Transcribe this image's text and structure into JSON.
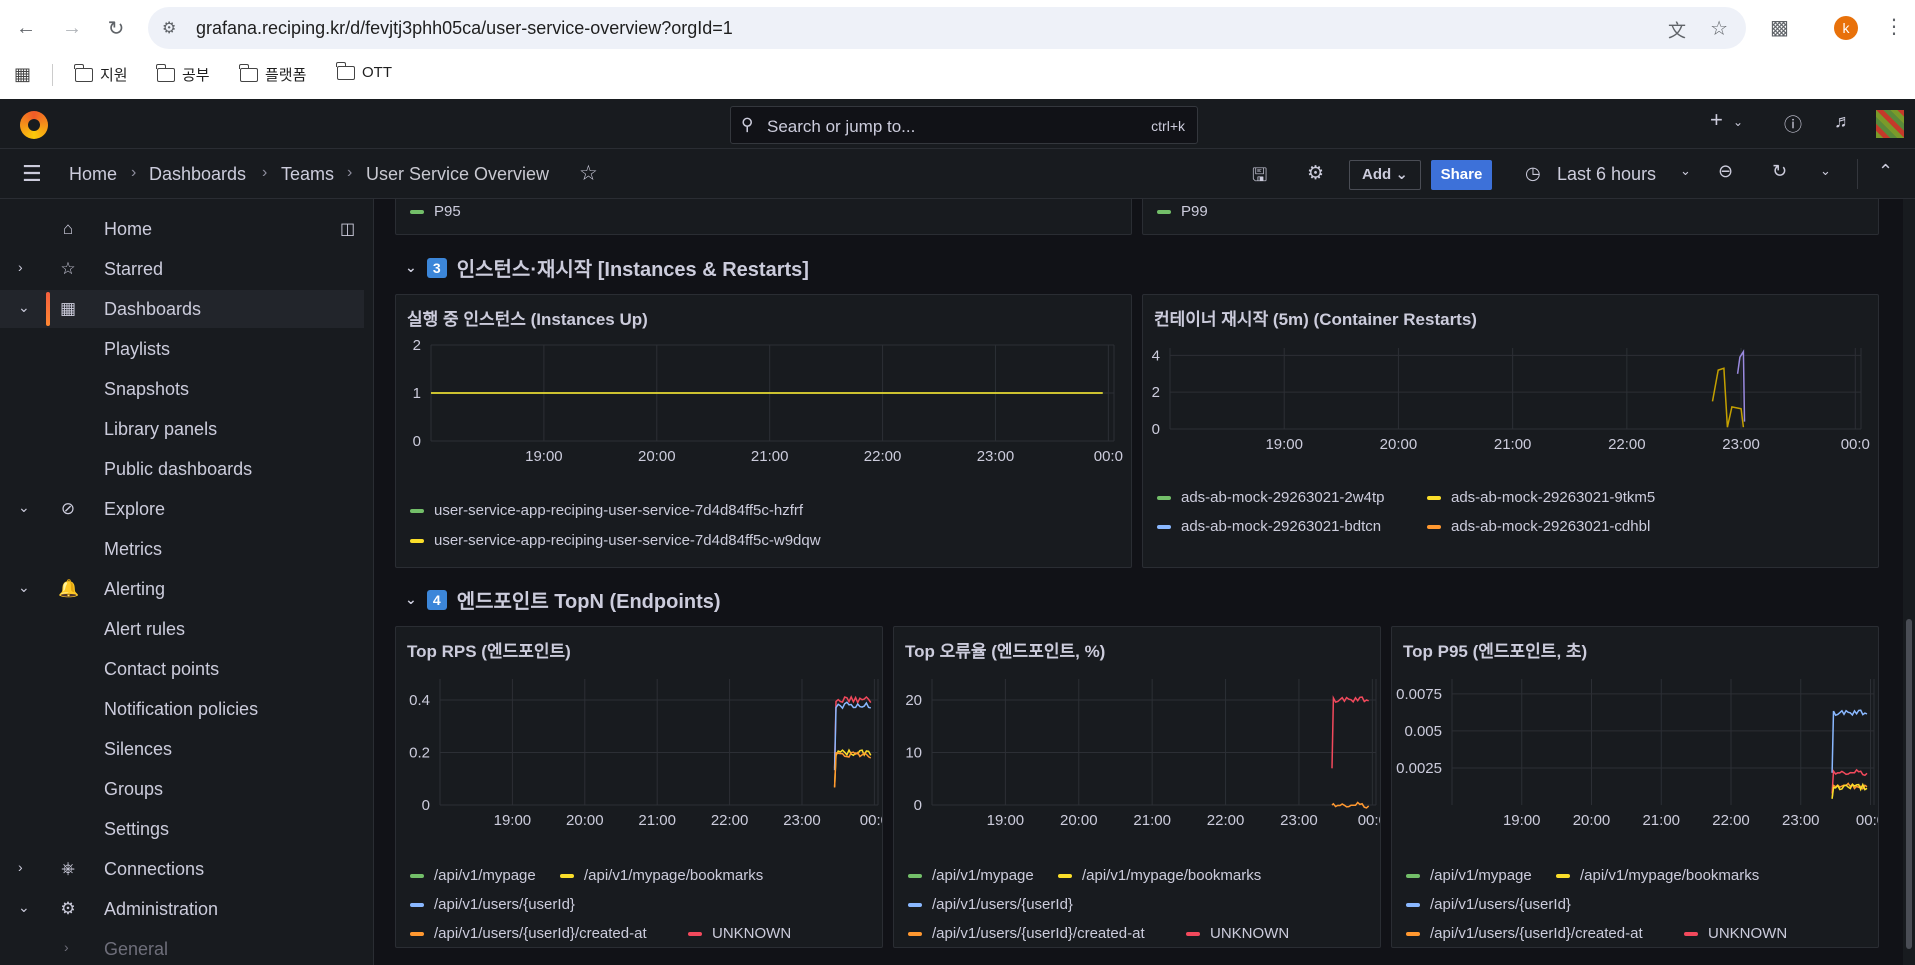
{
  "browser": {
    "url": "grafana.reciping.kr/d/fevjtj3phh05ca/user-service-overview?orgId=1",
    "bookmarks": [
      "지원",
      "공부",
      "플랫폼",
      "OTT"
    ],
    "profile_initial": "k"
  },
  "header": {
    "search_placeholder": "Search or jump to...",
    "search_shortcut": "ctrl+k"
  },
  "breadcrumb": {
    "home": "Home",
    "dashboards": "Dashboards",
    "teams": "Teams",
    "current": "User Service Overview"
  },
  "toolbar": {
    "add_label": "Add",
    "share_label": "Share",
    "time_range": "Last 6 hours"
  },
  "sidebar": {
    "items": [
      {
        "label": "Home",
        "icon": "home-icon"
      },
      {
        "label": "Starred",
        "icon": "star-icon"
      },
      {
        "label": "Dashboards",
        "icon": "apps-icon"
      },
      {
        "label": "Playlists"
      },
      {
        "label": "Snapshots"
      },
      {
        "label": "Library panels"
      },
      {
        "label": "Public dashboards"
      },
      {
        "label": "Explore",
        "icon": "compass-icon"
      },
      {
        "label": "Metrics"
      },
      {
        "label": "Alerting",
        "icon": "bell-icon"
      },
      {
        "label": "Alert rules"
      },
      {
        "label": "Contact points"
      },
      {
        "label": "Notification policies"
      },
      {
        "label": "Silences"
      },
      {
        "label": "Groups"
      },
      {
        "label": "Settings"
      },
      {
        "label": "Connections",
        "icon": "connections-icon"
      },
      {
        "label": "Administration",
        "icon": "cog-icon"
      },
      {
        "label": "General"
      }
    ]
  },
  "top_legends": {
    "left": "P95",
    "right": "P99"
  },
  "rows": {
    "row3": {
      "badge": "3",
      "title": "인스턴스·재시작 [Instances & Restarts]"
    },
    "row4": {
      "badge": "4",
      "title": "엔드포인트 TopN (Endpoints)"
    }
  },
  "panels": {
    "instances": {
      "title": "실행 중 인스턴스 (Instances Up)",
      "legend": [
        {
          "name": "user-service-app-reciping-user-service-7d4d84ff5c-hzfrf",
          "color": "#73bf69"
        },
        {
          "name": "user-service-app-reciping-user-service-7d4d84ff5c-w9dqw",
          "color": "#fade2a"
        }
      ]
    },
    "restarts": {
      "title": "컨테이너 재시작 (5m) (Container Restarts)",
      "legend": [
        {
          "name": "ads-ab-mock-29263021-2w4tp",
          "color": "#73bf69"
        },
        {
          "name": "ads-ab-mock-29263021-9tkm5",
          "color": "#fade2a"
        },
        {
          "name": "ads-ab-mock-29263021-bdtcn",
          "color": "#8ab8ff"
        },
        {
          "name": "ads-ab-mock-29263021-cdhbl",
          "color": "#ff9830"
        }
      ]
    },
    "top_rps": {
      "title": "Top RPS (엔드포인트)"
    },
    "top_err": {
      "title": "Top 오류율 (엔드포인트, %)"
    },
    "top_p95": {
      "title": "Top P95 (엔드포인트, 초)"
    },
    "endpoint_legend": [
      {
        "name": "/api/v1/mypage",
        "color": "#73bf69"
      },
      {
        "name": "/api/v1/mypage/bookmarks",
        "color": "#fade2a"
      },
      {
        "name": "/api/v1/users/{userId}",
        "color": "#8ab8ff"
      },
      {
        "name": "/api/v1/users/{userId}/created-at",
        "color": "#ff9830"
      },
      {
        "name": "UNKNOWN",
        "color": "#f2495c"
      }
    ]
  },
  "chart_data": [
    {
      "type": "line",
      "title": "실행 중 인스턴스 (Instances Up)",
      "x_ticks": [
        "19:00",
        "20:00",
        "21:00",
        "22:00",
        "23:00",
        "00:0"
      ],
      "y_ticks": [
        "0",
        "1",
        "2"
      ],
      "ylim": [
        0,
        2
      ],
      "series": [
        {
          "name": "user-service-app-reciping-user-service-7d4d84ff5c-hzfrf",
          "color": "#73bf69",
          "values": [
            1,
            1
          ]
        },
        {
          "name": "user-service-app-reciping-user-service-7d4d84ff5c-w9dqw",
          "color": "#fade2a",
          "values": [
            1,
            1
          ]
        }
      ]
    },
    {
      "type": "line",
      "title": "컨테이너 재시작 (5m) (Container Restarts)",
      "x_ticks": [
        "19:00",
        "20:00",
        "21:00",
        "22:00",
        "23:00",
        "00:0"
      ],
      "y_ticks": [
        "0",
        "2",
        "4"
      ],
      "ylim": [
        0,
        4.4
      ],
      "series": [
        {
          "name": "ads-ab-mock-29263021-9tkm5",
          "color": "#c4a000",
          "points": [
            [
              22.75,
              1.5
            ],
            [
              22.8,
              3.2
            ],
            [
              22.85,
              3.3
            ],
            [
              22.88,
              0.1
            ],
            [
              22.92,
              1.2
            ],
            [
              23.0,
              1.1
            ],
            [
              23.02,
              0.1
            ]
          ]
        },
        {
          "name": "ads-ab-mock-29263021-bdtcn",
          "color": "#9a8ae0",
          "points": [
            [
              22.97,
              3.0
            ],
            [
              22.99,
              3.9
            ],
            [
              23.02,
              4.2
            ],
            [
              23.03,
              0.4
            ]
          ]
        }
      ]
    },
    {
      "type": "line",
      "title": "Top RPS (엔드포인트)",
      "x_ticks": [
        "19:00",
        "20:00",
        "21:00",
        "22:00",
        "23:00",
        "00:0"
      ],
      "y_ticks": [
        "0",
        "0.2",
        "0.4"
      ],
      "ylim": [
        0,
        0.48
      ],
      "series": [
        {
          "name": "UNKNOWN",
          "color": "#f2495c",
          "start": 23.45,
          "level": 0.4
        },
        {
          "name": "/api/v1/users/{userId}",
          "color": "#8ab8ff",
          "start": 23.45,
          "level": 0.38
        },
        {
          "name": "/api/v1/mypage/bookmarks",
          "color": "#fade2a",
          "start": 23.45,
          "level": 0.2
        },
        {
          "name": "/api/v1/users/{userId}/created-at",
          "color": "#ff9830",
          "start": 23.45,
          "level": 0.19
        }
      ]
    },
    {
      "type": "line",
      "title": "Top 오류율 (엔드포인트, %)",
      "x_ticks": [
        "19:00",
        "20:00",
        "21:00",
        "22:00",
        "23:00",
        "00:0"
      ],
      "y_ticks": [
        "0",
        "10",
        "20"
      ],
      "ylim": [
        0,
        24
      ],
      "series": [
        {
          "name": "UNKNOWN",
          "color": "#f2495c",
          "start": 23.45,
          "level": 20
        },
        {
          "name": "/api/v1/users/{userId}/created-at",
          "color": "#ff9830",
          "start": 23.45,
          "level": 0
        }
      ]
    },
    {
      "type": "line",
      "title": "Top P95 (엔드포인트, 초)",
      "x_ticks": [
        "19:00",
        "20:00",
        "21:00",
        "22:00",
        "23:00",
        "00:0"
      ],
      "y_ticks": [
        "0.0025",
        "0.005",
        "0.0075"
      ],
      "ylim": [
        0,
        0.0085
      ],
      "series": [
        {
          "name": "/api/v1/users/{userId}",
          "color": "#8ab8ff",
          "start": 23.45,
          "level": 0.0062
        },
        {
          "name": "UNKNOWN",
          "color": "#f2495c",
          "start": 23.45,
          "level": 0.0022
        },
        {
          "name": "/api/v1/users/{userId}/created-at",
          "color": "#ff9830",
          "start": 23.45,
          "level": 0.0013
        },
        {
          "name": "/api/v1/mypage/bookmarks",
          "color": "#fade2a",
          "start": 23.45,
          "level": 0.0012
        }
      ]
    }
  ]
}
